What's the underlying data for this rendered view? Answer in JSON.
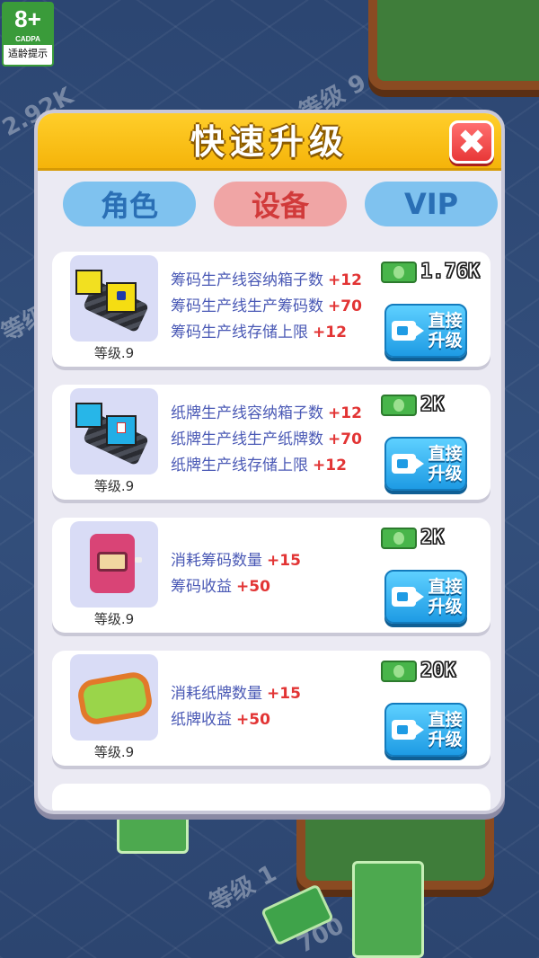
{
  "age_rating": {
    "number": "8+",
    "org": "CADPA",
    "tip": "适龄提示"
  },
  "background": {
    "labels": [
      "等级 9",
      "2.92K",
      "等级",
      "等级 1",
      "700"
    ]
  },
  "modal": {
    "title": "快速升级",
    "close_icon": "close-icon"
  },
  "tabs": [
    {
      "label": "角色",
      "active": false
    },
    {
      "label": "设备",
      "active": true
    },
    {
      "label": "VIP",
      "active": false
    }
  ],
  "cards": [
    {
      "level": "等级.9",
      "thumb_icon": "chip-production-line-icon",
      "stats": [
        {
          "text": "筹码生产线容纳箱子数",
          "plus": "+12"
        },
        {
          "text": "筹码生产线生产筹码数",
          "plus": "+70"
        },
        {
          "text": "筹码生产线存储上限",
          "plus": "+12"
        }
      ],
      "price": "1.76K",
      "button_line1": "直接",
      "button_line2": "升级"
    },
    {
      "level": "等级.9",
      "thumb_icon": "card-production-line-icon",
      "stats": [
        {
          "text": "纸牌生产线容纳箱子数",
          "plus": "+12"
        },
        {
          "text": "纸牌生产线生产纸牌数",
          "plus": "+70"
        },
        {
          "text": "纸牌生产线存储上限",
          "plus": "+12"
        }
      ],
      "price": "2K",
      "button_line1": "直接",
      "button_line2": "升级"
    },
    {
      "level": "等级.9",
      "thumb_icon": "slot-machine-icon",
      "stats": [
        {
          "text": "消耗筹码数量",
          "plus": "+15"
        },
        {
          "text": "筹码收益",
          "plus": "+50"
        }
      ],
      "price": "2K",
      "button_line1": "直接",
      "button_line2": "升级"
    },
    {
      "level": "等级.9",
      "thumb_icon": "card-table-icon",
      "stats": [
        {
          "text": "消耗纸牌数量",
          "plus": "+15"
        },
        {
          "text": "纸牌收益",
          "plus": "+50"
        }
      ],
      "price": "20K",
      "button_line1": "直接",
      "button_line2": "升级"
    }
  ],
  "colors": {
    "header": "#f5b40a",
    "tab_active": "#f0a5a5",
    "tab_inactive": "#7fc2ef",
    "stat_text": "#4a59b5",
    "stat_plus": "#e23434",
    "button": "#1e9be4"
  }
}
